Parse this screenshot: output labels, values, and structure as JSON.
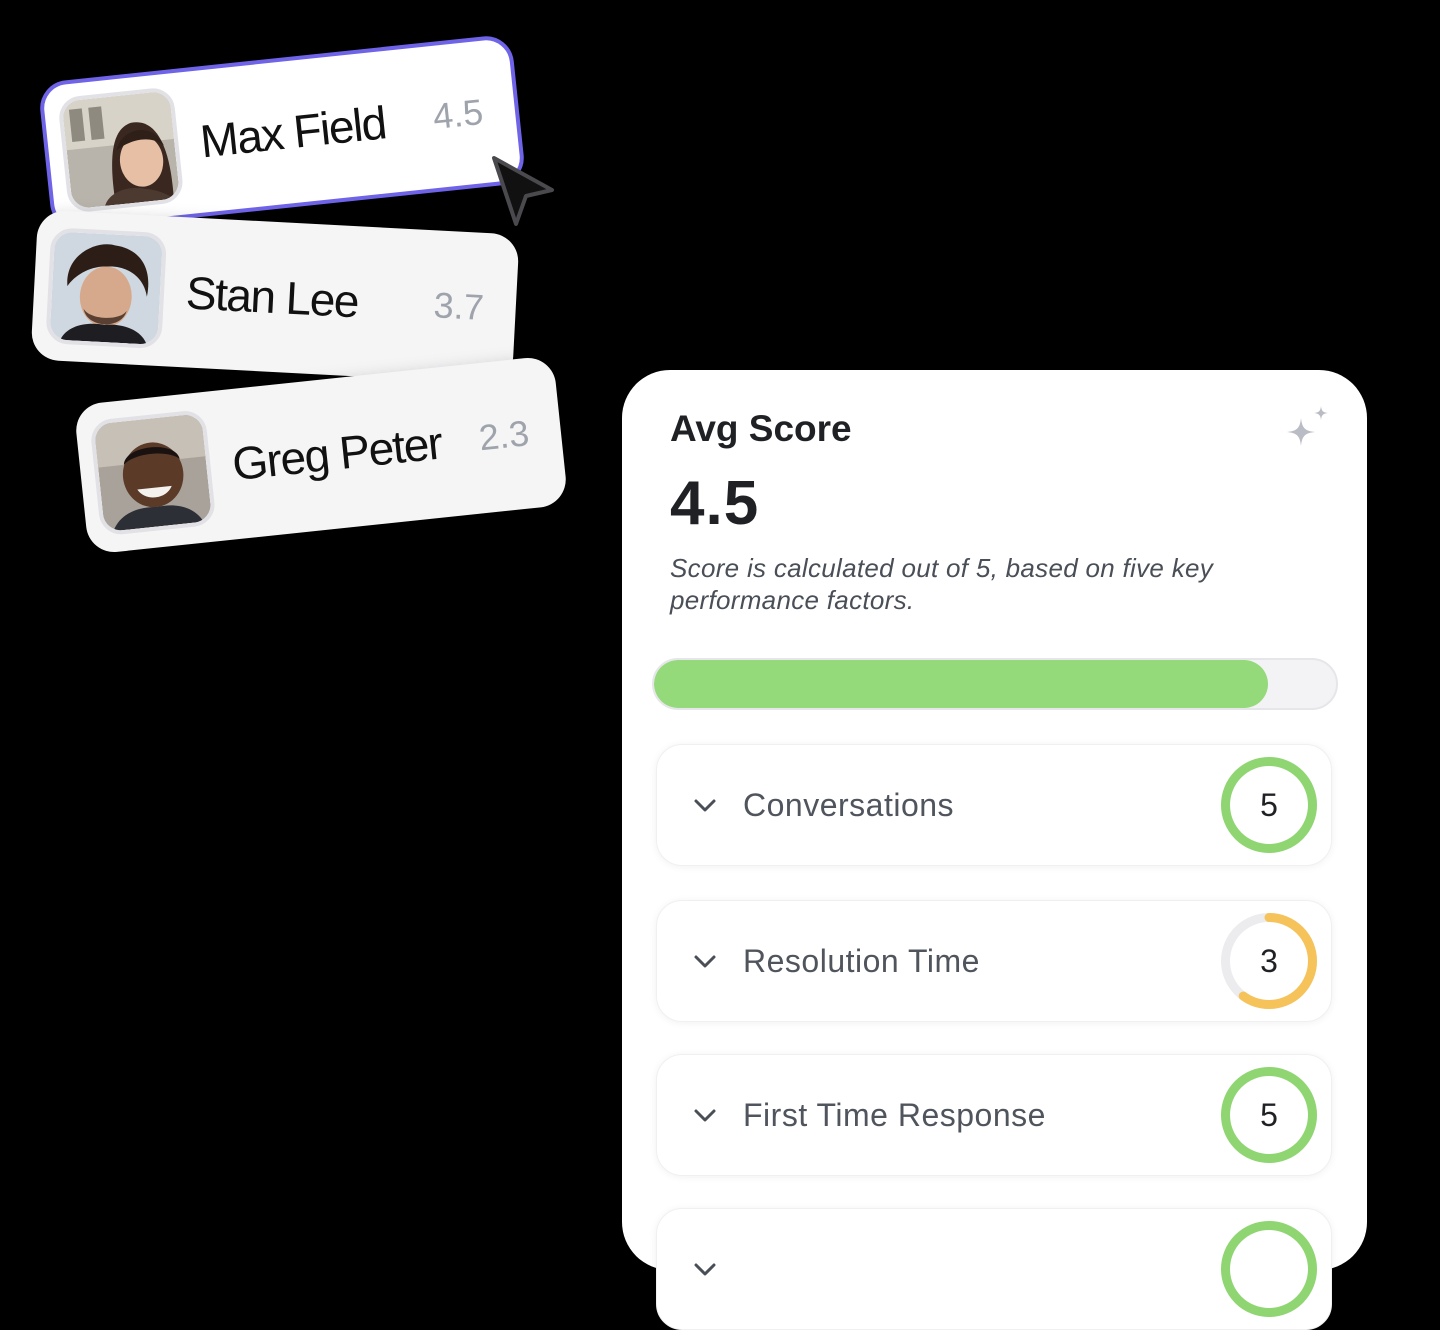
{
  "agents": [
    {
      "name": "Max Field",
      "score": "4.5",
      "avatar": "avatar-woman"
    },
    {
      "name": "Stan Lee",
      "score": "3.7",
      "avatar": "avatar-man-curly-hair"
    },
    {
      "name": "Greg Peter",
      "score": "2.3",
      "avatar": "avatar-man-smiling"
    }
  ],
  "panel": {
    "title": "Avg Score",
    "value": "4.5",
    "description": "Score is calculated out of 5, based on five key performance factors.",
    "progress_fraction": 0.9,
    "sparkle_icon": "sparkle-icon"
  },
  "factors": [
    {
      "label": "Conversations",
      "value": "5",
      "fraction": 1.0,
      "color": "#8fd672"
    },
    {
      "label": "Resolution Time",
      "value": "3",
      "fraction": 0.6,
      "color": "#f5c35a"
    },
    {
      "label": "First Time Response",
      "value": "5",
      "fraction": 1.0,
      "color": "#8fd672"
    },
    {
      "label": "",
      "value": "",
      "fraction": 1.0,
      "color": "#8fd672"
    }
  ],
  "colors": {
    "accent_selected": "#6f63e8",
    "progress": "#94d97a",
    "good": "#8fd672",
    "medium": "#f5c35a"
  }
}
